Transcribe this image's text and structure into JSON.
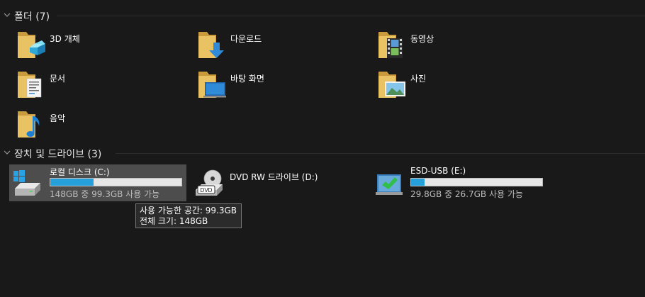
{
  "groups": {
    "folders": {
      "title": "폴더 (7)"
    },
    "devices": {
      "title": "장치 및 드라이브 (3)"
    }
  },
  "folders": [
    {
      "label": "3D 개체",
      "icon": "3d-objects-folder-icon"
    },
    {
      "label": "다운로드",
      "icon": "downloads-folder-icon"
    },
    {
      "label": "동영상",
      "icon": "videos-folder-icon"
    },
    {
      "label": "문서",
      "icon": "documents-folder-icon"
    },
    {
      "label": "바탕 화면",
      "icon": "desktop-folder-icon"
    },
    {
      "label": "사진",
      "icon": "pictures-folder-icon"
    },
    {
      "label": "음악",
      "icon": "music-folder-icon"
    }
  ],
  "drives": [
    {
      "name": "로컬 디스크 (C:)",
      "info": "148GB 중 99.3GB 사용 가능",
      "used_fraction": 0.33,
      "icon": "windows-drive-icon",
      "selected": true
    },
    {
      "name": "DVD RW 드라이브 (D:)",
      "icon": "dvd-drive-icon",
      "badge": "DVD"
    },
    {
      "name": "ESD-USB (E:)",
      "info": "29.8GB 중 26.7GB 사용 가능",
      "used_fraction": 0.1,
      "icon": "usb-drive-icon"
    }
  ],
  "tooltip": {
    "line1": "사용 가능한 공간: 99.3GB",
    "line2": "전체 크기: 148GB"
  },
  "colors": {
    "background": "#191919",
    "folder": "#e9c264",
    "bar_fill": "#26a0da",
    "bar_track": "#e6e6e6",
    "selection": "#4d4d4d"
  }
}
